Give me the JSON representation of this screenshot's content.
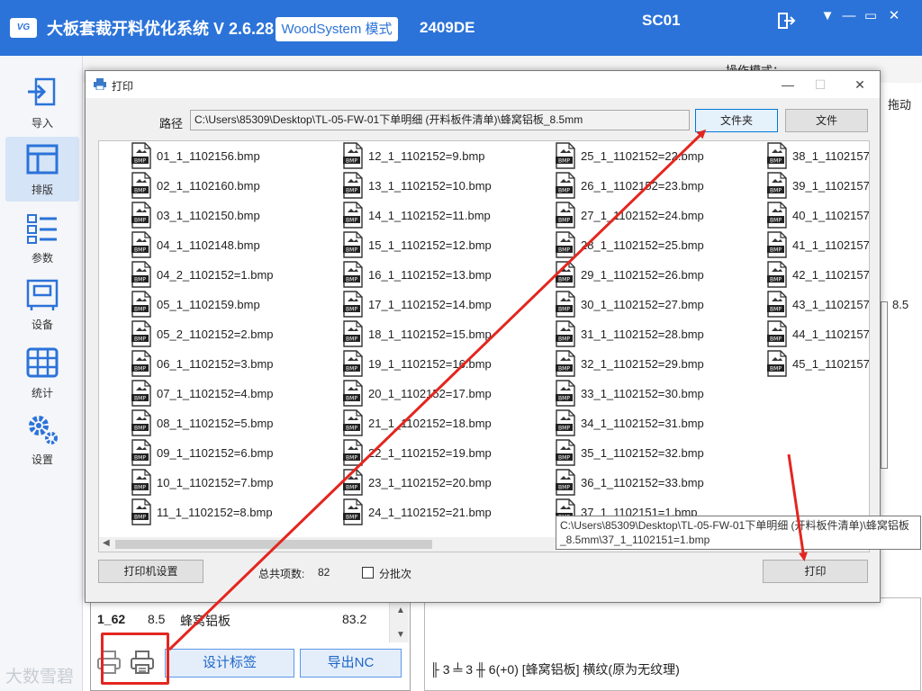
{
  "app": {
    "logo_text": "VG",
    "title": "大板套裁开料优化系统  V 2.6.28",
    "mode_badge": "WoodSystem 模式",
    "code": "2409DE",
    "station": "SC01",
    "colors": {
      "brand": "#2b73d9",
      "annotation_red": "#e3261f"
    }
  },
  "sidebar": {
    "items": [
      {
        "label": "导入",
        "icon": "import-icon"
      },
      {
        "label": "排版",
        "icon": "layout-icon",
        "active": true
      },
      {
        "label": "参数",
        "icon": "params-icon"
      },
      {
        "label": "设备",
        "icon": "device-icon"
      },
      {
        "label": "统计",
        "icon": "stats-icon"
      },
      {
        "label": "设置",
        "icon": "settings-icon"
      }
    ]
  },
  "background": {
    "opmode_label": "操作模式：",
    "side_text_a": "拖动",
    "side_text_b": "8.5",
    "list_row": {
      "id": "1_62",
      "thickness": "8.5",
      "material": "蜂窝铝板",
      "value": "83.2"
    },
    "status_line": "╟ 3 ╧ 3   ╫ 6(+0)    [蜂窝铝板]  横纹(原为无纹理)",
    "watermark": "大数雪碧",
    "buttons": {
      "design_label": "设计标签",
      "export_nc": "导出NC"
    }
  },
  "dialog": {
    "title": "打印",
    "path_label": "路径",
    "path_value": "C:\\Users\\85309\\Desktop\\TL-05-FW-01下单明细 (开料板件清单)\\蜂窝铝板_8.5mm",
    "folder_button": "文件夹",
    "file_button": "文件",
    "printer_settings_button": "打印机设置",
    "total_label": "总共项数:",
    "total_value": "82",
    "batch_label": "分批次",
    "print_button": "打印",
    "icon_badge": "BMP",
    "tooltip": "C:\\Users\\85309\\Desktop\\TL-05-FW-01下单明细 (开料板件清单)\\蜂窝铝板_8.5mm\\37_1_1102151=1.bmp",
    "columns": [
      [
        "01_1_1102156.bmp",
        "02_1_1102160.bmp",
        "03_1_1102150.bmp",
        "04_1_1102148.bmp",
        "04_2_1102152=1.bmp",
        "05_1_1102159.bmp",
        "05_2_1102152=2.bmp",
        "06_1_1102152=3.bmp",
        "07_1_1102152=4.bmp",
        "08_1_1102152=5.bmp",
        "09_1_1102152=6.bmp",
        "10_1_1102152=7.bmp",
        "11_1_1102152=8.bmp"
      ],
      [
        "12_1_1102152=9.bmp",
        "13_1_1102152=10.bmp",
        "14_1_1102152=11.bmp",
        "15_1_1102152=12.bmp",
        "16_1_1102152=13.bmp",
        "17_1_1102152=14.bmp",
        "18_1_1102152=15.bmp",
        "19_1_1102152=16.bmp",
        "20_1_1102152=17.bmp",
        "21_1_1102152=18.bmp",
        "22_1_1102152=19.bmp",
        "23_1_1102152=20.bmp",
        "24_1_1102152=21.bmp"
      ],
      [
        "25_1_1102152=22.bmp",
        "26_1_1102152=23.bmp",
        "27_1_1102152=24.bmp",
        "28_1_1102152=25.bmp",
        "29_1_1102152=26.bmp",
        "30_1_1102152=27.bmp",
        "31_1_1102152=28.bmp",
        "32_1_1102152=29.bmp",
        "33_1_1102152=30.bmp",
        "34_1_1102152=31.bmp",
        "35_1_1102152=32.bmp",
        "36_1_1102152=33.bmp",
        "37_1_1102151=1.bmp"
      ],
      [
        "38_1_1102157",
        "39_1_1102157",
        "40_1_1102157",
        "41_1_1102157",
        "42_1_1102157",
        "43_1_1102157",
        "44_1_1102157",
        "45_1_1102157"
      ]
    ]
  }
}
